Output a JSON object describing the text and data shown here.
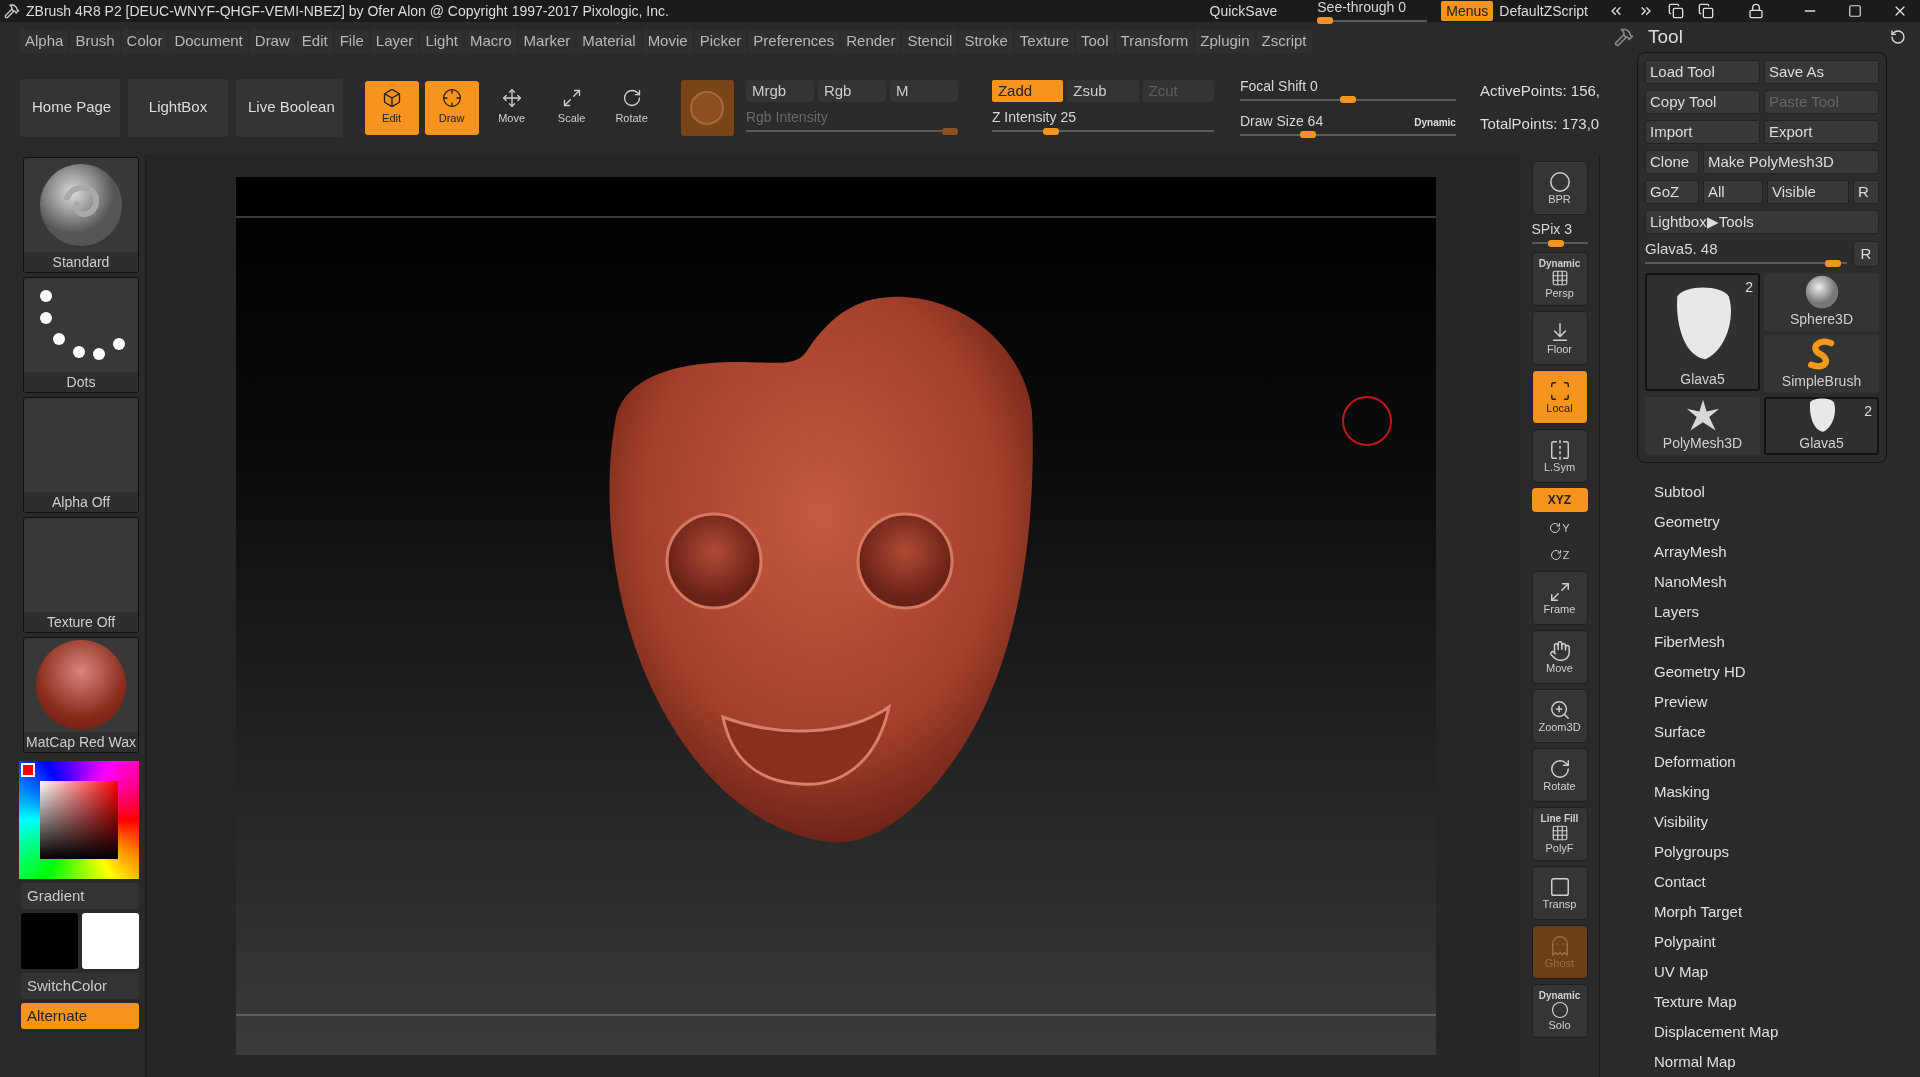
{
  "title_bar": {
    "title": "ZBrush 4R8 P2 [DEUC-WNYF-QHGF-VEMI-NBEZ] by Ofer Alon @ Copyright 1997-2017 Pixologic, Inc.",
    "quicksave": "QuickSave",
    "see_through": {
      "label": "See-through",
      "value": "0",
      "level": 0
    },
    "menus": {
      "label": "Menus",
      "on": true
    },
    "script": "DefaultZScript"
  },
  "menu_bar": [
    "Alpha",
    "Brush",
    "Color",
    "Document",
    "Draw",
    "Edit",
    "File",
    "Layer",
    "Light",
    "Macro",
    "Marker",
    "Material",
    "Movie",
    "Picker",
    "Preferences",
    "Render",
    "Stencil",
    "Stroke",
    "Texture",
    "Tool",
    "Transform",
    "Zplugin",
    "Zscript"
  ],
  "toolbar": {
    "nav": [
      "Home Page",
      "LightBox",
      "Live Boolean"
    ],
    "modes": [
      {
        "label": "Edit",
        "selected": true
      },
      {
        "label": "Draw",
        "selected": true
      },
      {
        "label": "Move",
        "selected": false
      },
      {
        "label": "Scale",
        "selected": false
      },
      {
        "label": "Rotate",
        "selected": false
      }
    ],
    "color_channels": [
      {
        "label": "Mrgb",
        "selected": false
      },
      {
        "label": "Rgb",
        "selected": false
      },
      {
        "label": "M",
        "selected": false
      }
    ],
    "z_modes": [
      {
        "label": "Zadd",
        "selected": true,
        "disabled": false
      },
      {
        "label": "Zsub",
        "selected": false,
        "disabled": false
      },
      {
        "label": "Zcut",
        "selected": false,
        "disabled": true
      }
    ],
    "rgb_intensity": {
      "label": "Rgb Intensity",
      "level": 1,
      "disabled": true
    },
    "z_intensity": {
      "label": "Z Intensity",
      "value": "25",
      "level": 0.25,
      "disabled": false
    },
    "focal_shift": {
      "label": "Focal Shift",
      "value": "0",
      "level": 0.5,
      "disabled": false
    },
    "draw_size": {
      "label": "Draw Size",
      "value": "64",
      "level": 0.3,
      "disabled": false
    },
    "dynamic": "Dynamic",
    "stats": [
      "ActivePoints: 156,",
      "TotalPoints: 173,0"
    ]
  },
  "left_shelf": {
    "thumbnails": [
      {
        "label": "Standard",
        "kind": "brush"
      },
      {
        "label": "Dots",
        "kind": "stroke"
      },
      {
        "label": "Alpha Off",
        "kind": "empty"
      },
      {
        "label": "Texture Off",
        "kind": "empty"
      },
      {
        "label": "MatCap Red Wax",
        "kind": "material"
      }
    ],
    "gradient": "Gradient",
    "swatches": [
      {
        "color": "#000000"
      },
      {
        "color": "#ffffff"
      }
    ],
    "switch_color": "SwitchColor",
    "alternate": {
      "label": "Alternate",
      "on": true
    }
  },
  "right_shelf": [
    {
      "kind": "button",
      "label": "BPR",
      "selected": false,
      "disabled": false
    },
    {
      "kind": "slider",
      "label": "SPix 3",
      "level": 0.4
    },
    {
      "kind": "button",
      "caption": "Dynamic",
      "label": "Persp",
      "selected": false,
      "disabled": false
    },
    {
      "kind": "button",
      "label": "Floor",
      "selected": false,
      "disabled": false
    },
    {
      "kind": "button",
      "label": "Local",
      "selected": true,
      "disabled": false
    },
    {
      "kind": "button",
      "label": "L.Sym",
      "selected": false,
      "disabled": false
    },
    {
      "kind": "small",
      "label": "XYZ",
      "selected": true
    },
    {
      "kind": "axis",
      "label": "Y",
      "selected": false
    },
    {
      "kind": "axis",
      "label": "Z",
      "selected": false
    },
    {
      "kind": "button",
      "label": "Frame",
      "selected": false,
      "disabled": false
    },
    {
      "kind": "button",
      "label": "Move",
      "selected": false,
      "disabled": false
    },
    {
      "kind": "button",
      "label": "Zoom3D",
      "selected": false,
      "disabled": false
    },
    {
      "kind": "button",
      "label": "Rotate",
      "selected": false,
      "disabled": false
    },
    {
      "kind": "button",
      "caption": "Line Fill",
      "label": "PolyF",
      "selected": false,
      "disabled": false
    },
    {
      "kind": "button",
      "label": "Transp",
      "selected": false,
      "disabled": false
    },
    {
      "kind": "button",
      "label": "Ghost",
      "selected": true,
      "disabled": true
    },
    {
      "kind": "button",
      "caption": "Dynamic",
      "label": "Solo",
      "selected": false,
      "disabled": false
    }
  ],
  "tool_panel": {
    "title": "Tool",
    "actions": [
      [
        {
          "label": "Load Tool",
          "disabled": false
        },
        {
          "label": "Save As",
          "disabled": false
        }
      ],
      [
        {
          "label": "Copy Tool",
          "disabled": false
        },
        {
          "label": "Paste Tool",
          "disabled": true
        }
      ],
      [
        {
          "label": "Import",
          "disabled": false
        },
        {
          "label": "Export",
          "disabled": false
        }
      ],
      [
        {
          "label": "Clone",
          "disabled": false
        },
        {
          "label": "Make PolyMesh3D",
          "disabled": false
        }
      ],
      [
        {
          "label": "GoZ",
          "disabled": false
        },
        {
          "label": "All",
          "disabled": false
        },
        {
          "label": "Visible",
          "disabled": false
        },
        {
          "label": "R",
          "disabled": false
        }
      ],
      [
        {
          "label": "Lightbox▶Tools",
          "disabled": false
        }
      ]
    ],
    "subtool_slider": {
      "label": "Glava5.",
      "value": "48",
      "level": 0.97
    },
    "reset": "R",
    "tools": [
      {
        "label": "Glava5",
        "kind": "tooth",
        "count": "2",
        "selected": true
      },
      {
        "label": "Sphere3D",
        "kind": "sphere",
        "selected": false
      },
      {
        "label": "SimpleBrush",
        "kind": "brush",
        "selected": false
      },
      {
        "label": "PolyMesh3D",
        "kind": "star",
        "selected": false
      },
      {
        "label": "Glava5",
        "kind": "tooth",
        "count": "2",
        "selected": true
      }
    ],
    "sections": [
      "Subtool",
      "Geometry",
      "ArrayMesh",
      "NanoMesh",
      "Layers",
      "FiberMesh",
      "Geometry HD",
      "Preview",
      "Surface",
      "Deformation",
      "Masking",
      "Visibility",
      "Polygroups",
      "Contact",
      "Morph Target",
      "Polypaint",
      "UV Map",
      "Texture Map",
      "Displacement Map",
      "Normal Map"
    ]
  }
}
